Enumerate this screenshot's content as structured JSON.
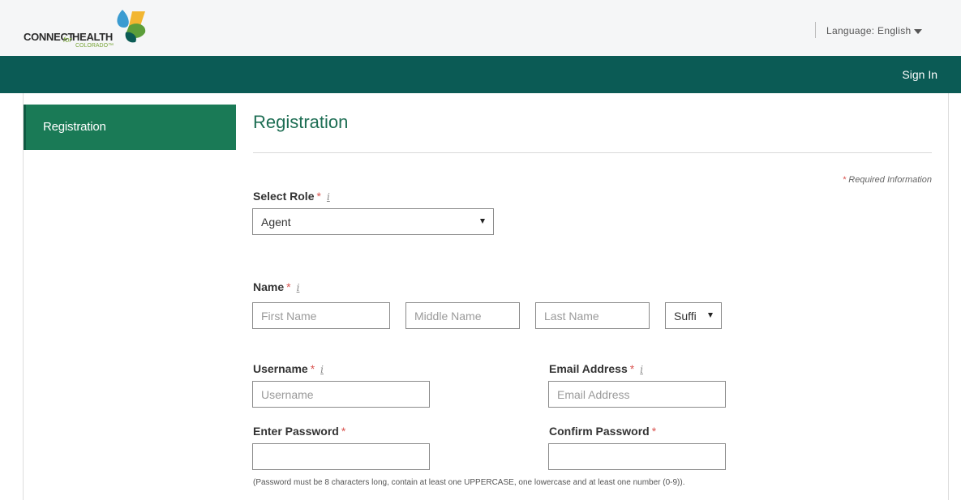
{
  "header": {
    "logo": {
      "part1": "CONNECT",
      "part2": "for",
      "part3": "HEALTH",
      "part4": "COLORADO™"
    },
    "language_label": "Language: English"
  },
  "nav": {
    "sign_in": "Sign In"
  },
  "sidebar": {
    "items": [
      {
        "label": "Registration",
        "active": true
      }
    ]
  },
  "main": {
    "title": "Registration",
    "required_note_star": "*",
    "required_note": "Required Information",
    "role": {
      "label": "Select Role",
      "value": "Agent"
    },
    "name": {
      "label": "Name",
      "first_placeholder": "First Name",
      "middle_placeholder": "Middle Name",
      "last_placeholder": "Last Name",
      "suffix_value": "Suffi"
    },
    "username": {
      "label": "Username",
      "placeholder": "Username"
    },
    "email": {
      "label": "Email Address",
      "placeholder": "Email Address"
    },
    "password": {
      "label": "Enter Password"
    },
    "confirm_password": {
      "label": "Confirm Password"
    },
    "password_hint": "(Password must be 8 characters long, contain at least one UPPERCASE, one lowercase and at least one number (0-9))."
  },
  "colors": {
    "nav_bg": "#0b5b55",
    "sidebar_active": "#1a7a56",
    "title": "#1e6e54",
    "required_star": "#d9534f"
  }
}
